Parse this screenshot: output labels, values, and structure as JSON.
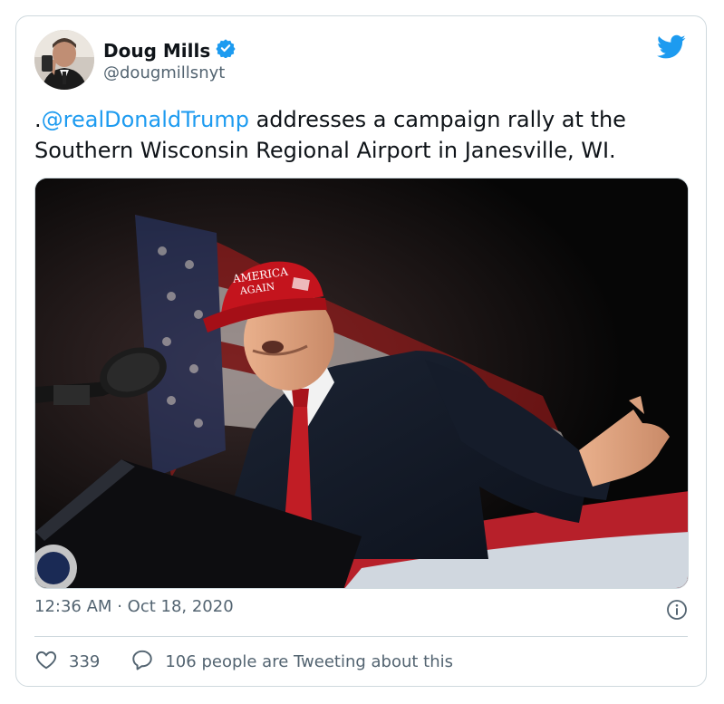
{
  "author": {
    "name": "Doug Mills",
    "handle": "@dougmillsnyt",
    "verified": true
  },
  "tweet": {
    "prefix": ".",
    "mention": "@realDonaldTrump",
    "text_after_mention": " addresses a campaign rally at the Southern Wisconsin Regional Airport in Janesville, WI.",
    "image_hat_text": "AMERICA AGAIN"
  },
  "meta": {
    "time": "12:36 AM",
    "separator": "·",
    "date": "Oct 18, 2020"
  },
  "actions": {
    "likes": "339",
    "replies_text": "106 people are Tweeting about this"
  },
  "colors": {
    "accent": "#1d9bf0",
    "secondary_text": "#536471",
    "border": "#cfd9de"
  },
  "icons": [
    "avatar-photo",
    "verified-badge-icon",
    "twitter-bird-icon",
    "info-icon",
    "heart-icon",
    "comment-icon"
  ]
}
